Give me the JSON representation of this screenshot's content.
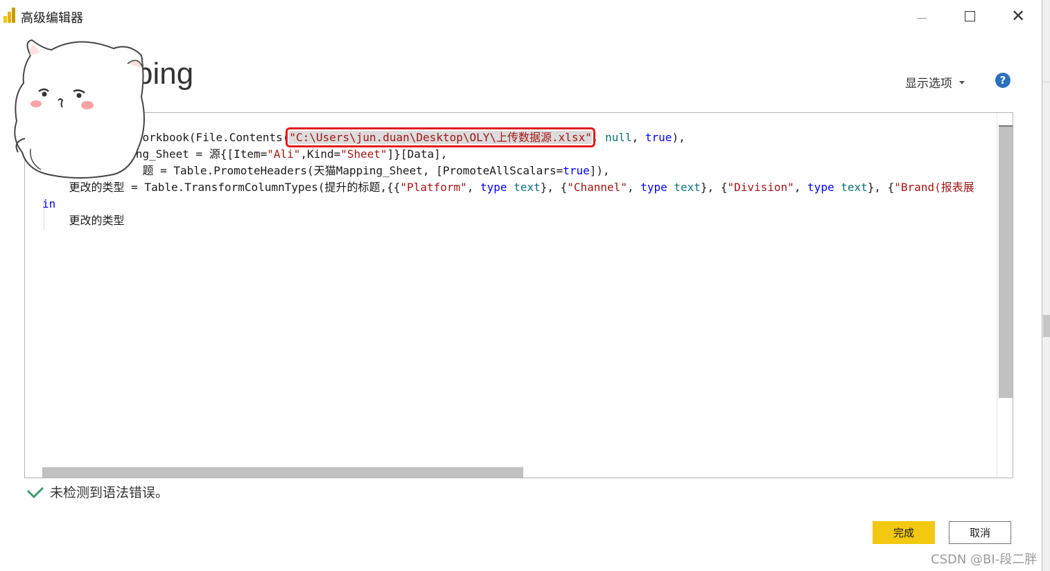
{
  "window": {
    "title": "高级编辑器",
    "minimize": "minimize",
    "maximize": "maximize",
    "close": "✕"
  },
  "header": {
    "query_name": "ping",
    "display_options_label": "显示选项",
    "help_glyph": "?"
  },
  "editor": {
    "lines": [
      {
        "parts": [
          {
            "t": "l.Workbook(File.Contents(",
            "c": "plain"
          },
          {
            "t": "\"C:\\Users\\jun.duan\\Desktop\\OLY\\上传数据源.xlsx\"",
            "c": "path"
          },
          {
            "t": ", ",
            "c": "plain"
          },
          {
            "t": "null",
            "c": "lit"
          },
          {
            "t": ", ",
            "c": "plain"
          },
          {
            "t": "true",
            "c": "kw"
          },
          {
            "t": "),",
            "c": "plain"
          }
        ],
        "indent": "            "
      },
      {
        "parts": [
          {
            "t": "ng_Sheet = 源{[Item=",
            "c": "plain"
          },
          {
            "t": "\"Ali\"",
            "c": "str"
          },
          {
            "t": ",Kind=",
            "c": "plain"
          },
          {
            "t": "\"Sheet\"",
            "c": "str"
          },
          {
            "t": "]}[Data],",
            "c": "plain"
          }
        ],
        "indent": "              "
      },
      {
        "parts": [
          {
            "t": "题 = Table.PromoteHeaders(天猫Mapping_Sheet, [PromoteAllScalars=",
            "c": "plain"
          },
          {
            "t": "true",
            "c": "kw"
          },
          {
            "t": "]),",
            "c": "plain"
          }
        ],
        "indent": "               "
      },
      {
        "parts": [
          {
            "t": "更改的类型 = Table.TransformColumnTypes(提升的标题,{{",
            "c": "plain"
          },
          {
            "t": "\"Platform\"",
            "c": "str"
          },
          {
            "t": ", ",
            "c": "plain"
          },
          {
            "t": "type",
            "c": "kw"
          },
          {
            "t": " ",
            "c": "plain"
          },
          {
            "t": "text",
            "c": "typ"
          },
          {
            "t": "}, {",
            "c": "plain"
          },
          {
            "t": "\"Channel\"",
            "c": "str"
          },
          {
            "t": ", ",
            "c": "plain"
          },
          {
            "t": "type",
            "c": "kw"
          },
          {
            "t": " ",
            "c": "plain"
          },
          {
            "t": "text",
            "c": "typ"
          },
          {
            "t": "}, {",
            "c": "plain"
          },
          {
            "t": "\"Division\"",
            "c": "str"
          },
          {
            "t": ", ",
            "c": "plain"
          },
          {
            "t": "type",
            "c": "kw"
          },
          {
            "t": " ",
            "c": "plain"
          },
          {
            "t": "text",
            "c": "typ"
          },
          {
            "t": "}, {",
            "c": "plain"
          },
          {
            "t": "\"Brand(报表展",
            "c": "str"
          }
        ],
        "indent": "    "
      },
      {
        "parts": [
          {
            "t": "in",
            "c": "kw"
          }
        ],
        "indent": ""
      },
      {
        "parts": [
          {
            "t": "更改的类型",
            "c": "plain"
          }
        ],
        "indent": "    "
      }
    ]
  },
  "status": {
    "message": "未检测到语法错误。"
  },
  "buttons": {
    "done": "完成",
    "cancel": "取消"
  },
  "watermark": "CSDN @BI-段二胖",
  "colors": {
    "accent_yellow": "#f2c811",
    "highlight_border": "#e21b1b",
    "check_green": "#3f9c6f",
    "keyword_blue": "#0000ff",
    "string_red": "#a31515"
  }
}
